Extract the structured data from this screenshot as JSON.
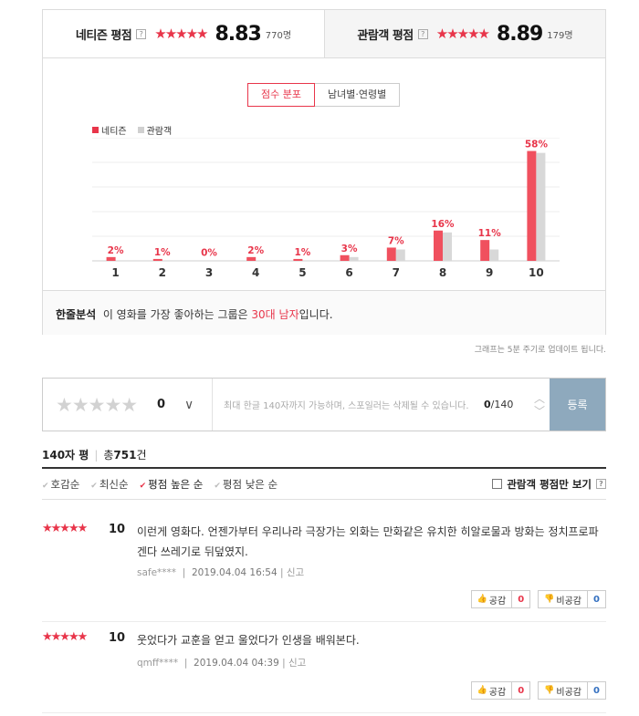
{
  "ratings": {
    "netizen": {
      "label": "네티즌 평점",
      "help": "?",
      "stars": "★★★★★",
      "score": "8.83",
      "count": "770명"
    },
    "audience": {
      "label": "관람객 평점",
      "help": "?",
      "stars": "★★★★★",
      "score": "8.89",
      "count": "179명"
    }
  },
  "subtabs": {
    "score_dist": "점수 분포",
    "gender_age": "남녀별·연령별"
  },
  "legend": {
    "netizen": "네티즌",
    "audience": "관람객"
  },
  "colors": {
    "accent": "#e8354a",
    "netizen_bar": "#f0505e",
    "audience_bar": "#d8d8d8",
    "register_btn": "#8ea9bd"
  },
  "chart_data": {
    "type": "bar",
    "categories": [
      "1",
      "2",
      "3",
      "4",
      "5",
      "6",
      "7",
      "8",
      "9",
      "10"
    ],
    "series": [
      {
        "name": "네티즌",
        "values": [
          2,
          1,
          0,
          2,
          1,
          3,
          7,
          16,
          11,
          58
        ],
        "labels": [
          "2%",
          "1%",
          "0%",
          "2%",
          "1%",
          "3%",
          "7%",
          "16%",
          "11%",
          "58%"
        ]
      },
      {
        "name": "관람객",
        "values": [
          0,
          0,
          0,
          0,
          0,
          2,
          6,
          15,
          6,
          57
        ]
      }
    ],
    "ylim": [
      0,
      65
    ],
    "grid": true,
    "legend_position": "top-left"
  },
  "oneline": {
    "title": "한줄분석",
    "pre": "이 영화를 가장 좋아하는 그룹은 ",
    "highlight": "30대 남자",
    "post": "입니다."
  },
  "update_note": "그래프는 5분 주기로 업데이트 됩니다.",
  "input": {
    "stars": "★★★★★",
    "rating": "0",
    "chevron": "∨",
    "placeholder": "최대 한글 140자까지 가능하며, 스포일러는 삭제될 수 있습니다.",
    "count_current": "0",
    "count_max": "/140",
    "up": "︿",
    "down": "﹀",
    "register": "등록"
  },
  "review_header": {
    "title": "140자 평",
    "total_pre": "총",
    "total_num": "751",
    "total_post": "건"
  },
  "filters": [
    {
      "label": "호감순",
      "active": false
    },
    {
      "label": "최신순",
      "active": false
    },
    {
      "label": "평점 높은 순",
      "active": true
    },
    {
      "label": "평점 낮은 순",
      "active": false
    }
  ],
  "audience_only": {
    "label": "관람객 평점만 보기",
    "help": "?"
  },
  "reviews": [
    {
      "stars": "★★★★★",
      "score": "10",
      "text": "이런게 영화다. 언젠가부터 우리나라 극장가는 외화는 만화같은 유치한 히알로물과 방화는 정치프로파겐다 쓰레기로 뒤덮였지.",
      "user": "safe****",
      "date": "2019.04.04 16:54",
      "report": "신고",
      "like_label": "공감",
      "like": "0",
      "dislike_label": "비공감",
      "dislike": "0"
    },
    {
      "stars": "★★★★★",
      "score": "10",
      "text": "웃었다가 교훈을 얻고 울었다가 인생을 배워본다.",
      "user": "qmff****",
      "date": "2019.04.04 04:39",
      "report": "신고",
      "like_label": "공감",
      "like": "0",
      "dislike_label": "비공감",
      "dislike": "0"
    }
  ]
}
